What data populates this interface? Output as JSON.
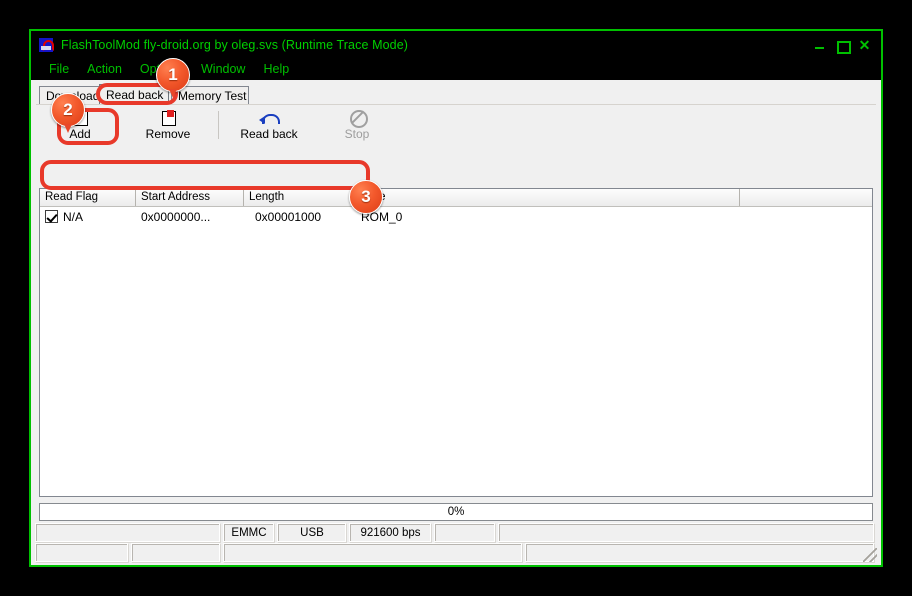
{
  "window": {
    "title": "FlashToolMod fly-droid.org by oleg.svs (Runtime Trace Mode)",
    "icon": "flashtool-app-icon",
    "controls": {
      "minimize": "–",
      "maximize": "□",
      "close": "✕"
    },
    "border_color": "#00c000",
    "title_color": "#00d000"
  },
  "menubar": {
    "items": [
      {
        "label": "File"
      },
      {
        "label": "Action"
      },
      {
        "label": "Options"
      },
      {
        "label": "Window"
      },
      {
        "label": "Help"
      }
    ]
  },
  "tabs": {
    "items": [
      {
        "label": "Download",
        "selected": false
      },
      {
        "label": "Read back",
        "selected": true
      },
      {
        "label": "Memory Test",
        "selected": false
      }
    ]
  },
  "toolbar": {
    "add_label": "Add",
    "remove_label": "Remove",
    "readback_label": "Read back",
    "stop_label": "Stop",
    "stop_disabled": true
  },
  "listview": {
    "columns": [
      "Read Flag",
      "Start Address",
      "Length",
      "File",
      ""
    ],
    "rows": [
      {
        "checked": true,
        "read_flag": "N/A",
        "start_address": "0x0000000...",
        "length": "0x00001000",
        "file": "ROM_0"
      }
    ]
  },
  "progress": {
    "text": "0%",
    "percent": 0
  },
  "statusbar": {
    "row1": [
      "",
      "EMMC",
      "USB",
      "921600 bps",
      "",
      ""
    ],
    "row2": [
      "",
      "",
      "",
      ""
    ]
  },
  "annotations": {
    "badges": [
      {
        "number": "1"
      },
      {
        "number": "2"
      },
      {
        "number": "3"
      }
    ]
  }
}
